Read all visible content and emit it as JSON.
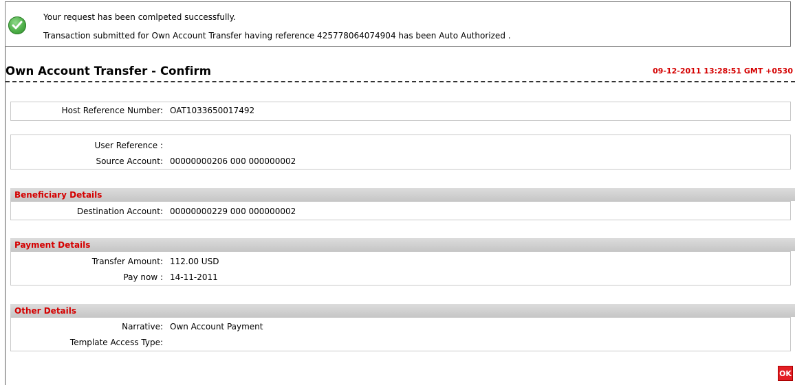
{
  "message": {
    "line1": "Your request has been comlpeted successfully.",
    "line2": "Transaction submitted for Own Account Transfer having reference 425778064074904 has been Auto Authorized ."
  },
  "header": {
    "title": "Own Account Transfer - Confirm",
    "timestamp": "09-12-2011 13:28:51 GMT +0530"
  },
  "host": {
    "label": "Host Reference Number:",
    "value": "OAT1033650017492"
  },
  "reference": {
    "user_ref_label": "User Reference :",
    "user_ref_value": "",
    "source_label": "Source Account:",
    "source_value": "00000000206 000 000000002"
  },
  "beneficiary": {
    "title": "Beneficiary Details",
    "dest_label": "Destination Account:",
    "dest_value": "00000000229 000 000000002"
  },
  "payment": {
    "title": "Payment Details",
    "amount_label": "Transfer Amount:",
    "amount_value": "112.00 USD",
    "paynow_label": "Pay now :",
    "paynow_value": "14-11-2011"
  },
  "other": {
    "title": "Other Details",
    "narrative_label": "Narrative:",
    "narrative_value": "Own Account Payment",
    "template_label": "Template Access Type:",
    "template_value": ""
  },
  "actions": {
    "ok_label": "OK"
  },
  "colors": {
    "accent_red": "#d40000",
    "success_green": "#4cae46"
  }
}
